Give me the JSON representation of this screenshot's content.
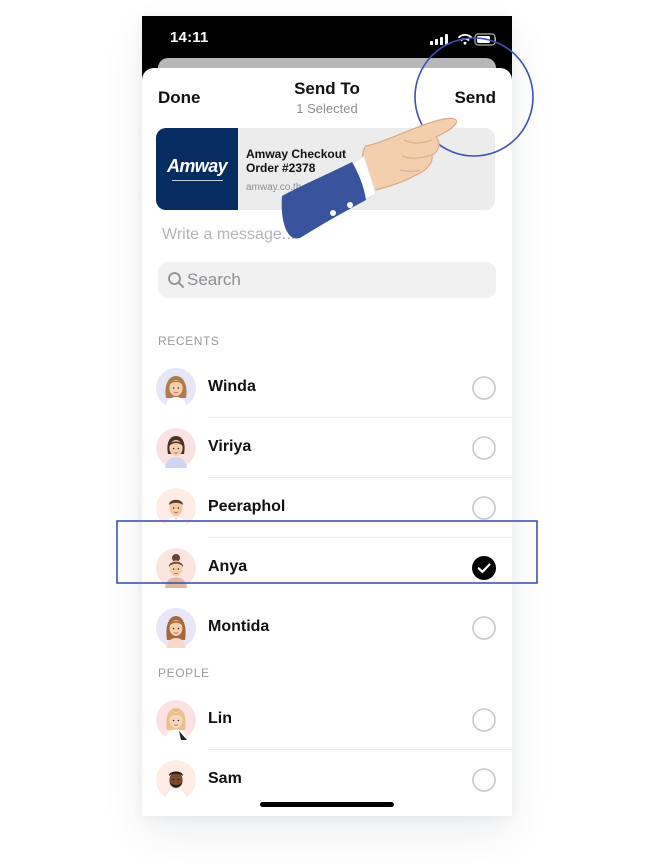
{
  "status_bar": {
    "time": "14:11"
  },
  "header": {
    "done_label": "Done",
    "title": "Send To",
    "subtitle": "1 Selected",
    "send_label": "Send"
  },
  "link_preview": {
    "logo_text": "Amway",
    "title": "Amway Checkout\nOrder #2378",
    "url": "amway.co.th"
  },
  "message": {
    "placeholder": "Write a message..."
  },
  "search": {
    "placeholder": "Search"
  },
  "sections": {
    "recents": "RECENTS",
    "people": "PEOPLE"
  },
  "recents": [
    {
      "name": "Winda",
      "selected": false
    },
    {
      "name": "Viriya",
      "selected": false
    },
    {
      "name": "Peeraphol",
      "selected": false
    },
    {
      "name": "Anya",
      "selected": true
    },
    {
      "name": "Montida",
      "selected": false
    }
  ],
  "people": [
    {
      "name": "Lin",
      "selected": false
    },
    {
      "name": "Sam",
      "selected": false
    }
  ],
  "colors": {
    "highlight": "#3f51b5",
    "thumbnail": "#062c62",
    "sleeve": "#3a539d",
    "skin": "#f4cfae",
    "checked": "#000000",
    "unchecked_ring": "#c7c7cc"
  },
  "icons": {
    "search": "magnifier",
    "selected": "checkmark-circle",
    "unselected": "empty-circle",
    "pointer": "pointing-hand"
  }
}
